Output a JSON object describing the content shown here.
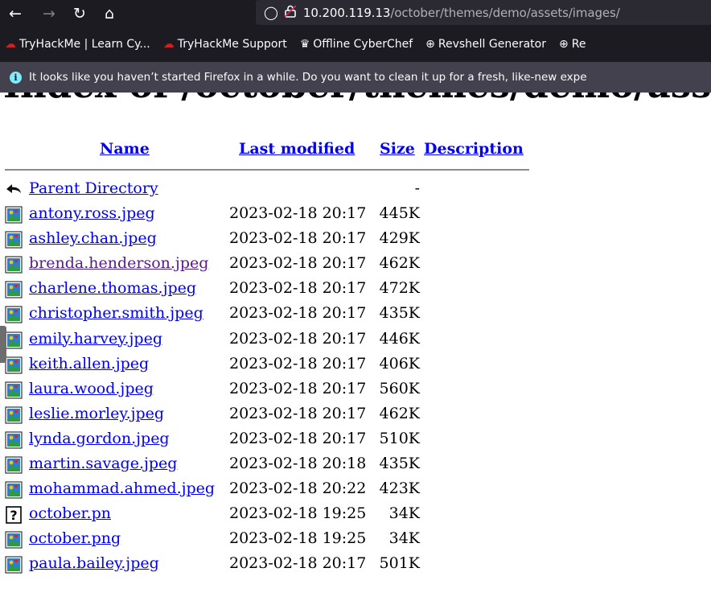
{
  "browser": {
    "back_glyph": "←",
    "forward_glyph": "→",
    "reload_glyph": "↻",
    "home_glyph": "⌂",
    "shield_glyph": "◯",
    "lock_glyph": "🔒",
    "url_host": "10.200.119.13",
    "url_path": "/october/themes/demo/assets/images/"
  },
  "bookmarks": [
    {
      "label": "TryHackMe | Learn Cy...",
      "icon": "tryhackme-icon",
      "glyph": "☁"
    },
    {
      "label": "TryHackMe Support",
      "icon": "tryhackme-icon",
      "glyph": "☁"
    },
    {
      "label": "Offline CyberChef",
      "icon": "cyberchef-icon",
      "glyph": "♛"
    },
    {
      "label": "Revshell Generator",
      "icon": "globe-icon",
      "glyph": "⊕"
    },
    {
      "label": "Re",
      "icon": "globe-icon",
      "glyph": "⊕"
    }
  ],
  "notification": {
    "text": "It looks like you haven’t started Firefox in a while. Do you want to clean it up for a fresh, like-new expe",
    "icon": "info-icon",
    "glyph": "i"
  },
  "page": {
    "heading": "Index of /october/themes/demo/assets/images",
    "columns": {
      "name": "Name",
      "last_modified": "Last modified",
      "size": "Size",
      "description": "Description"
    },
    "parent": {
      "label": "Parent Directory",
      "size": "-"
    },
    "files": [
      {
        "name": "antony.ross.jpeg",
        "modified": "2023-02-18 20:17",
        "size": "445K",
        "icon": "image-file-icon",
        "visited": false
      },
      {
        "name": "ashley.chan.jpeg",
        "modified": "2023-02-18 20:17",
        "size": "429K",
        "icon": "image-file-icon",
        "visited": false
      },
      {
        "name": "brenda.henderson.jpeg",
        "modified": "2023-02-18 20:17",
        "size": "462K",
        "icon": "image-file-icon",
        "visited": true
      },
      {
        "name": "charlene.thomas.jpeg",
        "modified": "2023-02-18 20:17",
        "size": "472K",
        "icon": "image-file-icon",
        "visited": false
      },
      {
        "name": "christopher.smith.jpeg",
        "modified": "2023-02-18 20:17",
        "size": "435K",
        "icon": "image-file-icon",
        "visited": false
      },
      {
        "name": "emily.harvey.jpeg",
        "modified": "2023-02-18 20:17",
        "size": "446K",
        "icon": "image-file-icon",
        "visited": false
      },
      {
        "name": "keith.allen.jpeg",
        "modified": "2023-02-18 20:17",
        "size": "406K",
        "icon": "image-file-icon",
        "visited": false
      },
      {
        "name": "laura.wood.jpeg",
        "modified": "2023-02-18 20:17",
        "size": "560K",
        "icon": "image-file-icon",
        "visited": false
      },
      {
        "name": "leslie.morley.jpeg",
        "modified": "2023-02-18 20:17",
        "size": "462K",
        "icon": "image-file-icon",
        "visited": false
      },
      {
        "name": "lynda.gordon.jpeg",
        "modified": "2023-02-18 20:17",
        "size": "510K",
        "icon": "image-file-icon",
        "visited": false
      },
      {
        "name": "martin.savage.jpeg",
        "modified": "2023-02-18 20:18",
        "size": "435K",
        "icon": "image-file-icon",
        "visited": false
      },
      {
        "name": "mohammad.ahmed.jpeg",
        "modified": "2023-02-18 20:22",
        "size": "423K",
        "icon": "image-file-icon",
        "visited": false
      },
      {
        "name": "october.pn",
        "modified": "2023-02-18 19:25",
        "size": "34K",
        "icon": "unknown-file-icon",
        "visited": false
      },
      {
        "name": "october.png",
        "modified": "2023-02-18 19:25",
        "size": "34K",
        "icon": "image-file-icon",
        "visited": false
      },
      {
        "name": "paula.bailey.jpeg",
        "modified": "2023-02-18 20:17",
        "size": "501K",
        "icon": "image-file-icon",
        "visited": false
      }
    ]
  },
  "colors": {
    "chrome_bg": "#1c1b22",
    "notification_bg": "#42414d",
    "link": "#0000ee",
    "visited_link": "#551a8b"
  }
}
